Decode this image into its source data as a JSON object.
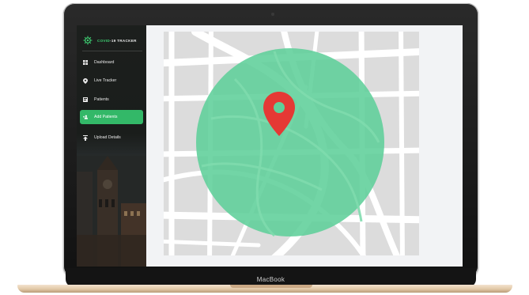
{
  "app": {
    "logo_text": "COVID-19 TRACKER",
    "logo_brand": "COVID",
    "logo_rest": "-19 TRACKER"
  },
  "sidebar": {
    "items": [
      {
        "label": "Dashboard",
        "icon": "dashboard-icon",
        "active": false
      },
      {
        "label": "Live Tracker",
        "icon": "location-pin-icon",
        "active": false
      },
      {
        "label": "Patients",
        "icon": "patients-icon",
        "active": false
      },
      {
        "label": "Add Patients",
        "icon": "add-user-icon",
        "active": true
      },
      {
        "label": "Upload Details",
        "icon": "upload-icon",
        "active": false
      }
    ]
  },
  "map": {
    "marker_icon": "map-marker-icon",
    "radius_fill_color": "#5fcf9a",
    "marker_color": "#e53935"
  },
  "device": {
    "brand_label": "MacBook"
  },
  "colors": {
    "accent": "#33b868",
    "sidebar_bg": "#1c1f1d",
    "map_bg": "#dedede",
    "road": "#ffffff"
  }
}
